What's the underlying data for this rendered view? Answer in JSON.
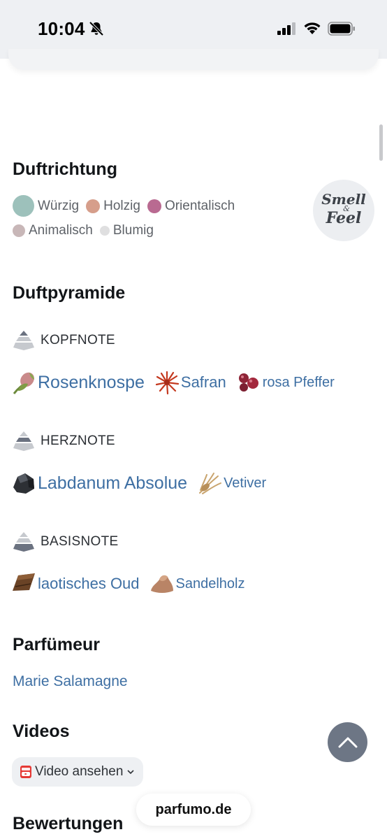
{
  "status_bar": {
    "time": "10:04"
  },
  "sections": {
    "duftrichtung": "Duftrichtung",
    "duftpyramide": "Duftpyramide",
    "parfumeur": "Parfümeur",
    "videos": "Videos",
    "bewertungen": "Bewertungen"
  },
  "scent_directions": [
    {
      "label": "Würzig",
      "color": "#9dc1bb"
    },
    {
      "label": "Holzig",
      "color": "#d69e8b"
    },
    {
      "label": "Orientalisch",
      "color": "#b96a91"
    },
    {
      "label": "Animalisch",
      "color": "#c8b7b8"
    },
    {
      "label": "Blumig",
      "color": "#dfdfe0"
    }
  ],
  "smell_feel": {
    "line1": "Smell",
    "amp": "&",
    "line2": "Feel"
  },
  "pyramid": {
    "top": {
      "label": "KOPFNOTE",
      "notes": [
        {
          "name": "Rosenknospe",
          "icon": "rosebud-icon"
        },
        {
          "name": "Safran",
          "icon": "saffron-icon"
        },
        {
          "name": "rosa Pfeffer",
          "icon": "pink-pepper-icon"
        }
      ]
    },
    "heart": {
      "label": "HERZNOTE",
      "notes": [
        {
          "name": "Labdanum Absolue",
          "icon": "labdanum-icon"
        },
        {
          "name": "Vetiver",
          "icon": "vetiver-icon"
        }
      ]
    },
    "base": {
      "label": "BASISNOTE",
      "notes": [
        {
          "name": "laotisches Oud",
          "icon": "oud-icon"
        },
        {
          "name": "Sandelholz",
          "icon": "sandalwood-icon"
        }
      ]
    }
  },
  "perfumer": "Marie Salamagne",
  "video_button": {
    "label": "Video ansehen",
    "icon": "youtube-icon"
  },
  "browser": {
    "url": "parfumo.de"
  }
}
